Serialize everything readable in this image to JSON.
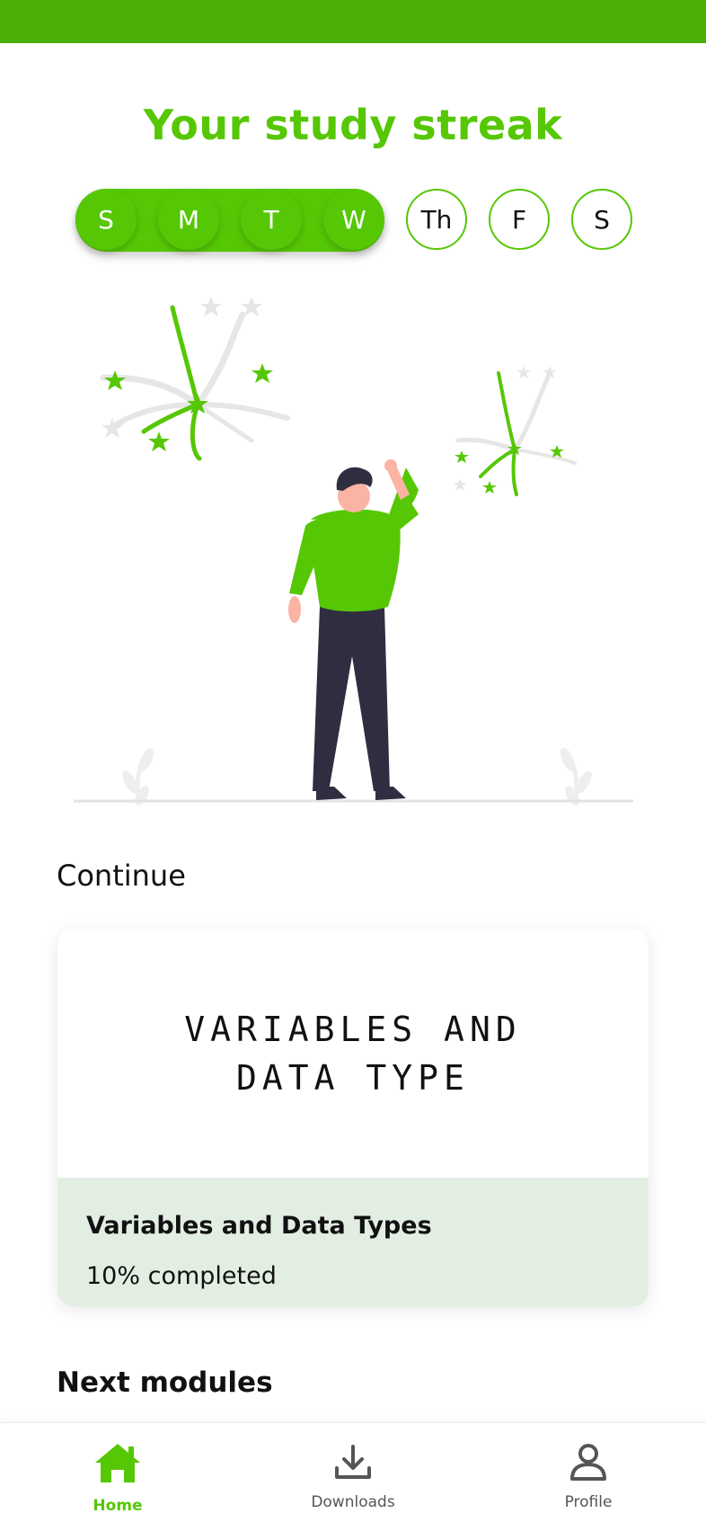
{
  "header": {
    "title": "Your study streak"
  },
  "streak": {
    "days": [
      {
        "label": "S",
        "done": true
      },
      {
        "label": "M",
        "done": true
      },
      {
        "label": "T",
        "done": true
      },
      {
        "label": "W",
        "done": true
      },
      {
        "label": "Th",
        "done": false
      },
      {
        "label": "F",
        "done": false
      },
      {
        "label": "S",
        "done": false
      }
    ]
  },
  "continue_section": {
    "label": "Continue",
    "card": {
      "hero_line1": "VARIABLES AND",
      "hero_line2": "DATA TYPE",
      "title": "Variables and Data Types",
      "progress_text": "10% completed",
      "progress": 0.1
    }
  },
  "next_section": {
    "label": "Next modules"
  },
  "bottom_nav": {
    "items": [
      {
        "label": "Home",
        "icon": "home-icon",
        "active": true
      },
      {
        "label": "Downloads",
        "icon": "download-icon",
        "active": false
      },
      {
        "label": "Profile",
        "icon": "profile-icon",
        "active": false
      }
    ]
  },
  "colors": {
    "accent": "#56c705",
    "topbar": "#4caf07",
    "card_footer": "#e2eee2"
  }
}
